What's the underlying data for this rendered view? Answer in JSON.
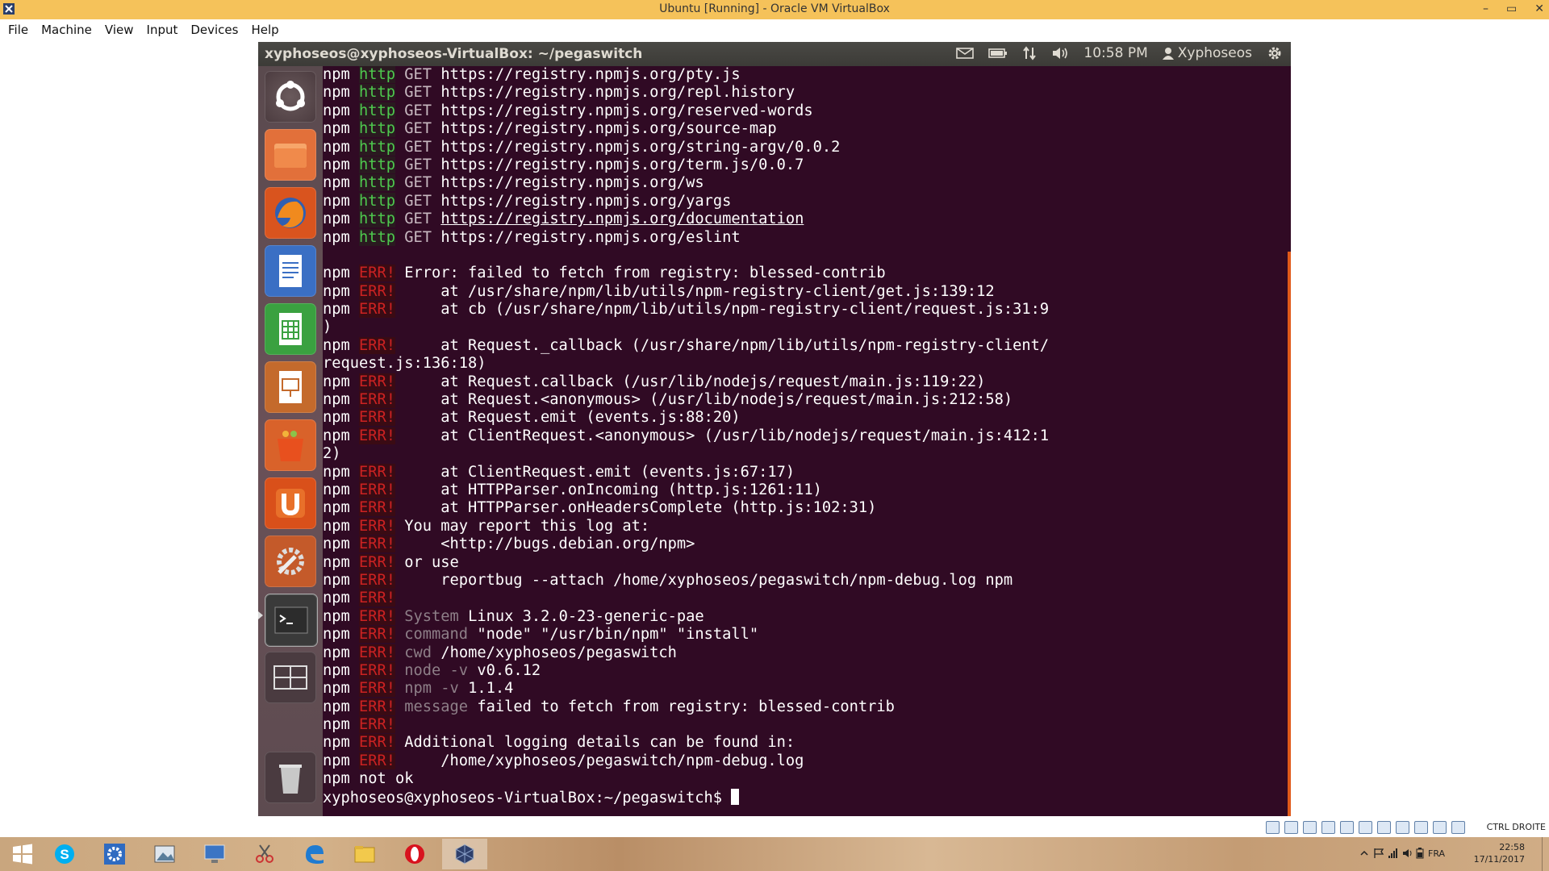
{
  "host_window": {
    "title": "Ubuntu [Running] - Oracle VM VirtualBox",
    "controls": [
      "–",
      "▭",
      "✕"
    ],
    "menu": [
      "File",
      "Machine",
      "View",
      "Input",
      "Devices",
      "Help"
    ],
    "status_host_key": "CTRL DROITE"
  },
  "guest_panel": {
    "window_title": "xyphoseos@xyphoseos-VirtualBox: ~/pegaswitch",
    "time": "10:58 PM",
    "user": "Xyphoseos",
    "indicators": [
      "mail-icon",
      "battery-icon",
      "network-icon",
      "volume-icon"
    ]
  },
  "launcher": {
    "items": [
      "dash-home",
      "files",
      "firefox",
      "writer",
      "calc",
      "impress",
      "software-center",
      "ubuntu-one",
      "system-settings",
      "terminal",
      "workspace-switcher",
      "trash"
    ]
  },
  "terminal": {
    "lines": [
      {
        "prefix": "npm",
        "tag": "http",
        "rest": [
          {
            "t": " GET ",
            "c": "p-get"
          },
          {
            "t": "https://registry.npmjs.org/pty.js"
          }
        ]
      },
      {
        "prefix": "npm",
        "tag": "http",
        "rest": [
          {
            "t": " GET ",
            "c": "p-get"
          },
          {
            "t": "https://registry.npmjs.org/repl.history"
          }
        ]
      },
      {
        "prefix": "npm",
        "tag": "http",
        "rest": [
          {
            "t": " GET ",
            "c": "p-get"
          },
          {
            "t": "https://registry.npmjs.org/reserved-words"
          }
        ]
      },
      {
        "prefix": "npm",
        "tag": "http",
        "rest": [
          {
            "t": " GET ",
            "c": "p-get"
          },
          {
            "t": "https://registry.npmjs.org/source-map"
          }
        ]
      },
      {
        "prefix": "npm",
        "tag": "http",
        "rest": [
          {
            "t": " GET ",
            "c": "p-get"
          },
          {
            "t": "https://registry.npmjs.org/string-argv/0.0.2"
          }
        ]
      },
      {
        "prefix": "npm",
        "tag": "http",
        "rest": [
          {
            "t": " GET ",
            "c": "p-get"
          },
          {
            "t": "https://registry.npmjs.org/term.js/0.0.7"
          }
        ]
      },
      {
        "prefix": "npm",
        "tag": "http",
        "rest": [
          {
            "t": " GET ",
            "c": "p-get"
          },
          {
            "t": "https://registry.npmjs.org/ws"
          }
        ]
      },
      {
        "prefix": "npm",
        "tag": "http",
        "rest": [
          {
            "t": " GET ",
            "c": "p-get"
          },
          {
            "t": "https://registry.npmjs.org/yargs"
          }
        ]
      },
      {
        "prefix": "npm",
        "tag": "http",
        "rest": [
          {
            "t": " GET ",
            "c": "p-get"
          },
          {
            "t": "https://registry.npmjs.org/documentation",
            "c": "underline"
          }
        ]
      },
      {
        "prefix": "npm",
        "tag": "http",
        "rest": [
          {
            "t": " GET ",
            "c": "p-get"
          },
          {
            "t": "https://registry.npmjs.org/eslint"
          }
        ]
      },
      {
        "prefix": "",
        "tag": "",
        "rest": []
      },
      {
        "prefix": "npm",
        "tag": "ERR!",
        "rest": [
          {
            "t": " Error: failed to fetch from registry: blessed-contrib"
          }
        ]
      },
      {
        "prefix": "npm",
        "tag": "ERR!",
        "rest": [
          {
            "t": "     at /usr/share/npm/lib/utils/npm-registry-client/get.js:139:12"
          }
        ]
      },
      {
        "prefix": "npm",
        "tag": "ERR!",
        "rest": [
          {
            "t": "     at cb (/usr/share/npm/lib/utils/npm-registry-client/request.js:31:9"
          }
        ]
      },
      {
        "prefix": "",
        "tag": "",
        "rest": [
          {
            "t": ")"
          }
        ]
      },
      {
        "prefix": "npm",
        "tag": "ERR!",
        "rest": [
          {
            "t": "     at Request._callback (/usr/share/npm/lib/utils/npm-registry-client/"
          }
        ]
      },
      {
        "prefix": "",
        "tag": "",
        "rest": [
          {
            "t": "request.js:136:18)"
          }
        ]
      },
      {
        "prefix": "npm",
        "tag": "ERR!",
        "rest": [
          {
            "t": "     at Request.callback (/usr/lib/nodejs/request/main.js:119:22)"
          }
        ]
      },
      {
        "prefix": "npm",
        "tag": "ERR!",
        "rest": [
          {
            "t": "     at Request.<anonymous> (/usr/lib/nodejs/request/main.js:212:58)"
          }
        ]
      },
      {
        "prefix": "npm",
        "tag": "ERR!",
        "rest": [
          {
            "t": "     at Request.emit (events.js:88:20)"
          }
        ]
      },
      {
        "prefix": "npm",
        "tag": "ERR!",
        "rest": [
          {
            "t": "     at ClientRequest.<anonymous> (/usr/lib/nodejs/request/main.js:412:1"
          }
        ]
      },
      {
        "prefix": "",
        "tag": "",
        "rest": [
          {
            "t": "2)"
          }
        ]
      },
      {
        "prefix": "npm",
        "tag": "ERR!",
        "rest": [
          {
            "t": "     at ClientRequest.emit (events.js:67:17)"
          }
        ]
      },
      {
        "prefix": "npm",
        "tag": "ERR!",
        "rest": [
          {
            "t": "     at HTTPParser.onIncoming (http.js:1261:11)"
          }
        ]
      },
      {
        "prefix": "npm",
        "tag": "ERR!",
        "rest": [
          {
            "t": "     at HTTPParser.onHeadersComplete (http.js:102:31)"
          }
        ]
      },
      {
        "prefix": "npm",
        "tag": "ERR!",
        "rest": [
          {
            "t": " You may report this log at:"
          }
        ]
      },
      {
        "prefix": "npm",
        "tag": "ERR!",
        "rest": [
          {
            "t": "     <http://bugs.debian.org/npm>"
          }
        ]
      },
      {
        "prefix": "npm",
        "tag": "ERR!",
        "rest": [
          {
            "t": " or use"
          }
        ]
      },
      {
        "prefix": "npm",
        "tag": "ERR!",
        "rest": [
          {
            "t": "     reportbug --attach /home/xyphoseos/pegaswitch/npm-debug.log npm"
          }
        ]
      },
      {
        "prefix": "npm",
        "tag": "ERR!",
        "rest": []
      },
      {
        "prefix": "npm",
        "tag": "ERR!",
        "rest": [
          {
            "t": " System",
            "c": "p-key"
          },
          {
            "t": " Linux 3.2.0-23-generic-pae"
          }
        ]
      },
      {
        "prefix": "npm",
        "tag": "ERR!",
        "rest": [
          {
            "t": " command",
            "c": "p-key"
          },
          {
            "t": " \"node\" \"/usr/bin/npm\" \"install\""
          }
        ]
      },
      {
        "prefix": "npm",
        "tag": "ERR!",
        "rest": [
          {
            "t": " cwd",
            "c": "p-key"
          },
          {
            "t": " /home/xyphoseos/pegaswitch"
          }
        ]
      },
      {
        "prefix": "npm",
        "tag": "ERR!",
        "rest": [
          {
            "t": " node -v",
            "c": "p-key"
          },
          {
            "t": " v0.6.12"
          }
        ]
      },
      {
        "prefix": "npm",
        "tag": "ERR!",
        "rest": [
          {
            "t": " npm -v",
            "c": "p-key"
          },
          {
            "t": " 1.1.4"
          }
        ]
      },
      {
        "prefix": "npm",
        "tag": "ERR!",
        "rest": [
          {
            "t": " message",
            "c": "p-key"
          },
          {
            "t": " failed to fetch from registry: blessed-contrib"
          }
        ]
      },
      {
        "prefix": "npm",
        "tag": "ERR!",
        "rest": []
      },
      {
        "prefix": "npm",
        "tag": "ERR!",
        "rest": [
          {
            "t": " Additional logging details can be found in:"
          }
        ]
      },
      {
        "prefix": "npm",
        "tag": "ERR!",
        "rest": [
          {
            "t": "     /home/xyphoseos/pegaswitch/npm-debug.log"
          }
        ]
      },
      {
        "prefix": "npm",
        "tag": "",
        "rest": [
          {
            "t": " not ok"
          }
        ]
      },
      {
        "prefix": "",
        "tag": "",
        "rest": [
          {
            "t": "xyphoseos@xyphoseos-VirtualBox:~/pegaswitch$ "
          }
        ],
        "cursor": true
      }
    ]
  },
  "taskbar": {
    "language": "FRA",
    "time": "22:58",
    "date": "17/11/2017",
    "apps": [
      "skype",
      "settings",
      "photos",
      "remote-desktop",
      "snipping-tool",
      "edge",
      "file-explorer",
      "opera",
      "virtualbox"
    ]
  },
  "colors": {
    "terminal_bg": "#300a24",
    "vbox_title": "#f5c25a",
    "http_tag": "#4ec94e",
    "err_tag": "#cc2222"
  }
}
